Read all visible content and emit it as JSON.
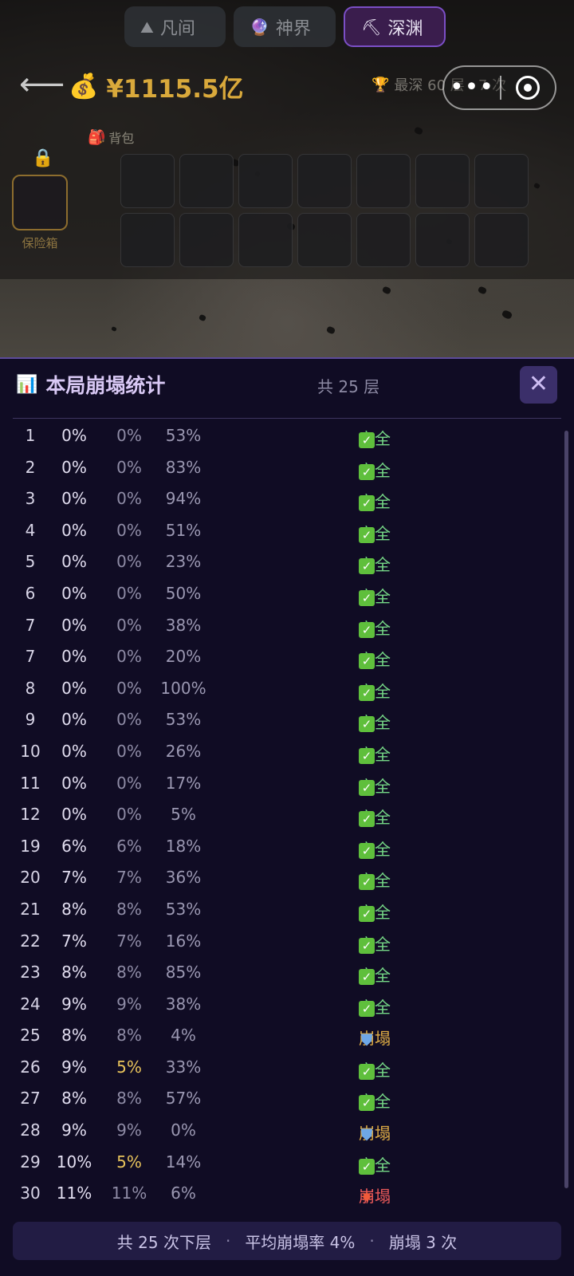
{
  "tabs": [
    {
      "icon": "⛰",
      "label": "凡间"
    },
    {
      "icon": "🔮",
      "label": "神界"
    },
    {
      "icon": "⛏",
      "label": "深渊"
    }
  ],
  "header": {
    "money": "¥1115.5亿",
    "best_text": "最深 60 层 · 7 次",
    "capsule_more": "•••"
  },
  "backpack": {
    "label": "背包"
  },
  "safe": {
    "label": "保险箱"
  },
  "panel": {
    "title": "本局崩塌统计",
    "count": "共 25 层",
    "close": "✕"
  },
  "rows": [
    {
      "layer": "1",
      "p1": "0%",
      "p2": "0%",
      "roll": "53%",
      "result": "安全"
    },
    {
      "layer": "2",
      "p1": "0%",
      "p2": "0%",
      "roll": "83%",
      "result": "安全"
    },
    {
      "layer": "3",
      "p1": "0%",
      "p2": "0%",
      "roll": "94%",
      "result": "安全"
    },
    {
      "layer": "4",
      "p1": "0%",
      "p2": "0%",
      "roll": "51%",
      "result": "安全"
    },
    {
      "layer": "5",
      "p1": "0%",
      "p2": "0%",
      "roll": "23%",
      "result": "安全"
    },
    {
      "layer": "6",
      "p1": "0%",
      "p2": "0%",
      "roll": "50%",
      "result": "安全"
    },
    {
      "layer": "7",
      "p1": "0%",
      "p2": "0%",
      "roll": "38%",
      "result": "安全"
    },
    {
      "layer": "7",
      "p1": "0%",
      "p2": "0%",
      "roll": "20%",
      "result": "安全"
    },
    {
      "layer": "8",
      "p1": "0%",
      "p2": "0%",
      "roll": "100%",
      "result": "安全"
    },
    {
      "layer": "9",
      "p1": "0%",
      "p2": "0%",
      "roll": "53%",
      "result": "安全"
    },
    {
      "layer": "10",
      "p1": "0%",
      "p2": "0%",
      "roll": "26%",
      "result": "安全"
    },
    {
      "layer": "11",
      "p1": "0%",
      "p2": "0%",
      "roll": "17%",
      "result": "安全"
    },
    {
      "layer": "12",
      "p1": "0%",
      "p2": "0%",
      "roll": "5%",
      "result": "安全"
    },
    {
      "layer": "19",
      "p1": "6%",
      "p2": "6%",
      "roll": "18%",
      "result": "安全"
    },
    {
      "layer": "20",
      "p1": "7%",
      "p2": "7%",
      "roll": "36%",
      "result": "安全"
    },
    {
      "layer": "21",
      "p1": "8%",
      "p2": "8%",
      "roll": "53%",
      "result": "安全"
    },
    {
      "layer": "22",
      "p1": "7%",
      "p2": "7%",
      "roll": "16%",
      "result": "安全"
    },
    {
      "layer": "23",
      "p1": "8%",
      "p2": "8%",
      "roll": "85%",
      "result": "安全"
    },
    {
      "layer": "24",
      "p1": "9%",
      "p2": "9%",
      "roll": "38%",
      "result": "安全"
    },
    {
      "layer": "25",
      "p1": "8%",
      "p2": "8%",
      "roll": "4%",
      "result": "崩塌",
      "type": "shield"
    },
    {
      "layer": "26",
      "p1": "9%",
      "p2": "5%",
      "roll": "33%",
      "result": "安全",
      "p2warn": true
    },
    {
      "layer": "27",
      "p1": "8%",
      "p2": "8%",
      "roll": "57%",
      "result": "安全"
    },
    {
      "layer": "28",
      "p1": "9%",
      "p2": "9%",
      "roll": "0%",
      "result": "崩塌",
      "type": "shield"
    },
    {
      "layer": "29",
      "p1": "10%",
      "p2": "5%",
      "roll": "14%",
      "result": "安全",
      "p2warn": true
    },
    {
      "layer": "30",
      "p1": "11%",
      "p2": "11%",
      "roll": "6%",
      "result": "崩塌",
      "type": "boom"
    }
  ],
  "footer": {
    "total": "共 25 次下层",
    "avg": "平均崩塌率 4%",
    "collapses": "崩塌 3 次",
    "sep": "·"
  },
  "colors": {
    "accent": "#7b4fc6",
    "gold": "#d9a93b",
    "safe": "#75d786",
    "collapse": "#e0ad45",
    "warn": "#e8c35b"
  }
}
